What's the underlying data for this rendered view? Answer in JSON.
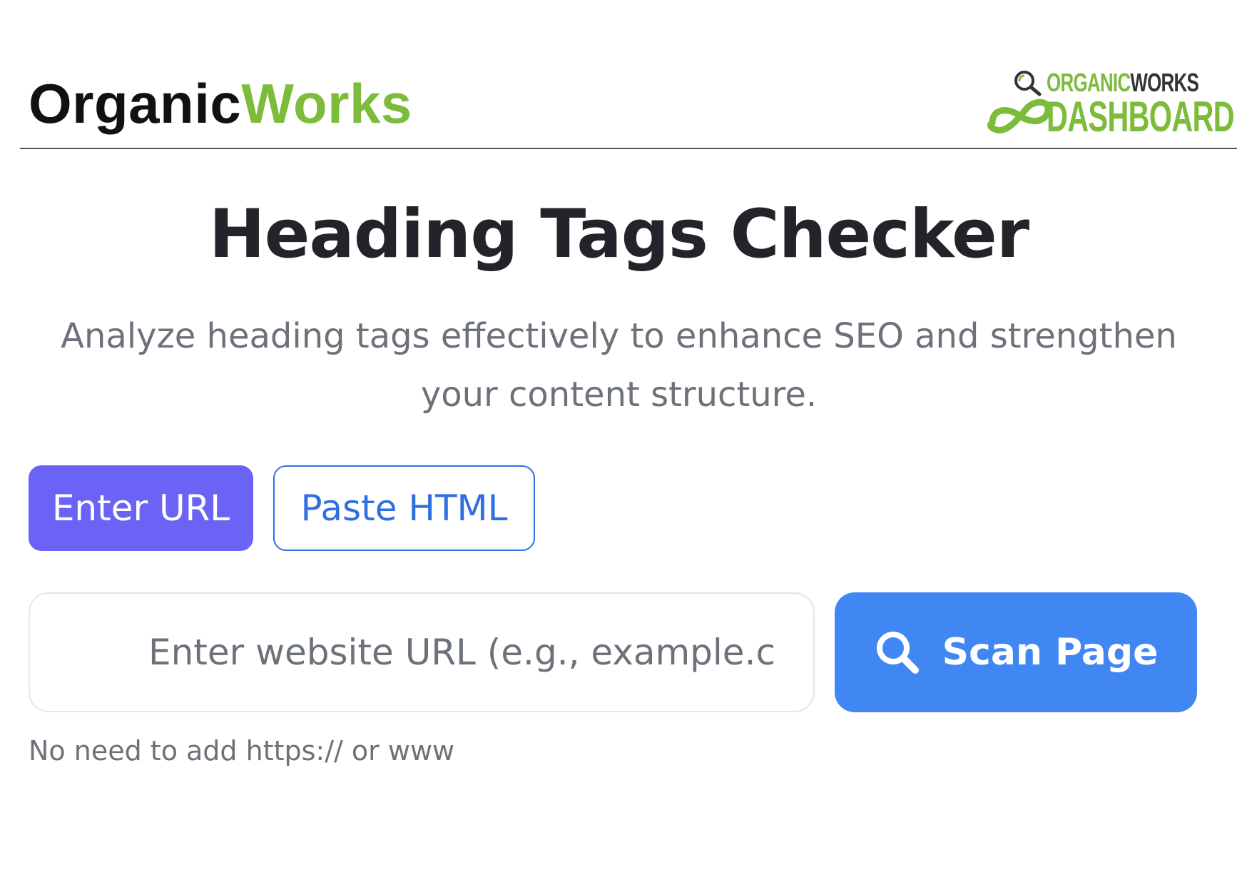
{
  "header": {
    "brand_part1": "Organic",
    "brand_part2": "Works",
    "logo_line1_part1": "ORGANIC",
    "logo_line1_part2": "WORKS",
    "logo_line2": "DASHBOARD"
  },
  "main": {
    "title": "Heading Tags Checker",
    "subtitle": "Analyze heading tags effectively to enhance SEO and strengthen your content structure.",
    "tabs": [
      {
        "label": "Enter URL",
        "active": true
      },
      {
        "label": "Paste HTML",
        "active": false
      }
    ],
    "url_input": {
      "value": "",
      "placeholder": "Enter website URL (e.g., example.com)"
    },
    "scan_button_label": "Scan Page",
    "hint": "No need to add https:// or www"
  },
  "colors": {
    "brand_green": "#7dbb3a",
    "tab_active_bg": "#6b63f5",
    "tab_outline": "#2f6fe0",
    "scan_button_bg": "#4187f3",
    "title_text": "#222429",
    "muted_text": "#6c717a"
  },
  "icons": {
    "scan_button": "search-icon",
    "logo_magnifier": "magnifier-icon",
    "logo_loop": "infinity-leaf-icon"
  }
}
